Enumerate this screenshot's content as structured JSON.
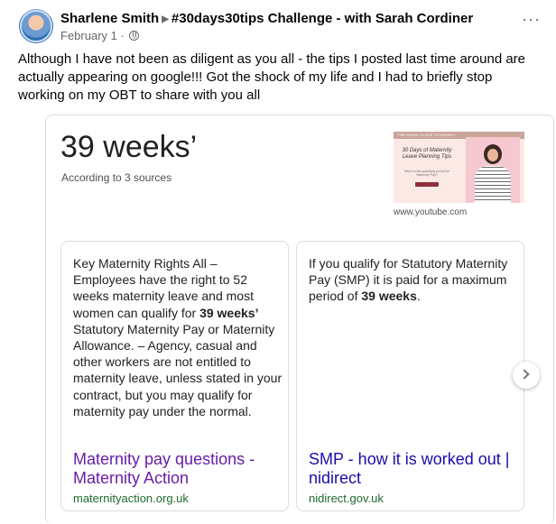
{
  "post": {
    "author": "Sharlene Smith",
    "group": "#30days30tips Challenge - with Sarah Cordiner",
    "date": "February 1",
    "separator": "·",
    "more": "···",
    "text": "Although I have not been as diligent as you all - the tips I posted last time around are actually appearing on google!!! Got the shock of my life and I had to briefly stop working on my OBT to share with you all"
  },
  "featured": {
    "title": "39 weeks’",
    "subtitle": "According to 3 sources",
    "thumbnail": {
      "band_text": "THE MOMS GUIDE TO MONEY",
      "title": "30 Days of Maternity Leave Planning Tips",
      "subtitle": "When is the qualifying period for Maternity Pay?"
    },
    "source": "www.youtube.com",
    "snippets": [
      {
        "text_before": "Key Maternity Rights All – Employees have the right to 52 weeks maternity leave and most women can qualify for ",
        "bold": "39 weeks’",
        "text_after": " Statutory Maternity Pay or Maternity Allowance. – Agency, casual and other workers are not entitled to maternity leave, unless stated in your contract, but you may qualify for maternity pay under the normal.",
        "link": "Maternity pay questions - Maternity Action",
        "domain": "maternityaction.org.uk"
      },
      {
        "text_before": "If you qualify for Statutory Maternity Pay (SMP) it is paid for a maximum period of ",
        "bold": "39 weeks",
        "text_after": ".",
        "link": "SMP - how it is worked out | nidirect",
        "domain": "nidirect.gov.uk"
      }
    ]
  },
  "colors": {
    "visited_link": "#681da8",
    "link": "#1a0dab",
    "domain_green": "#1e6b2e"
  }
}
